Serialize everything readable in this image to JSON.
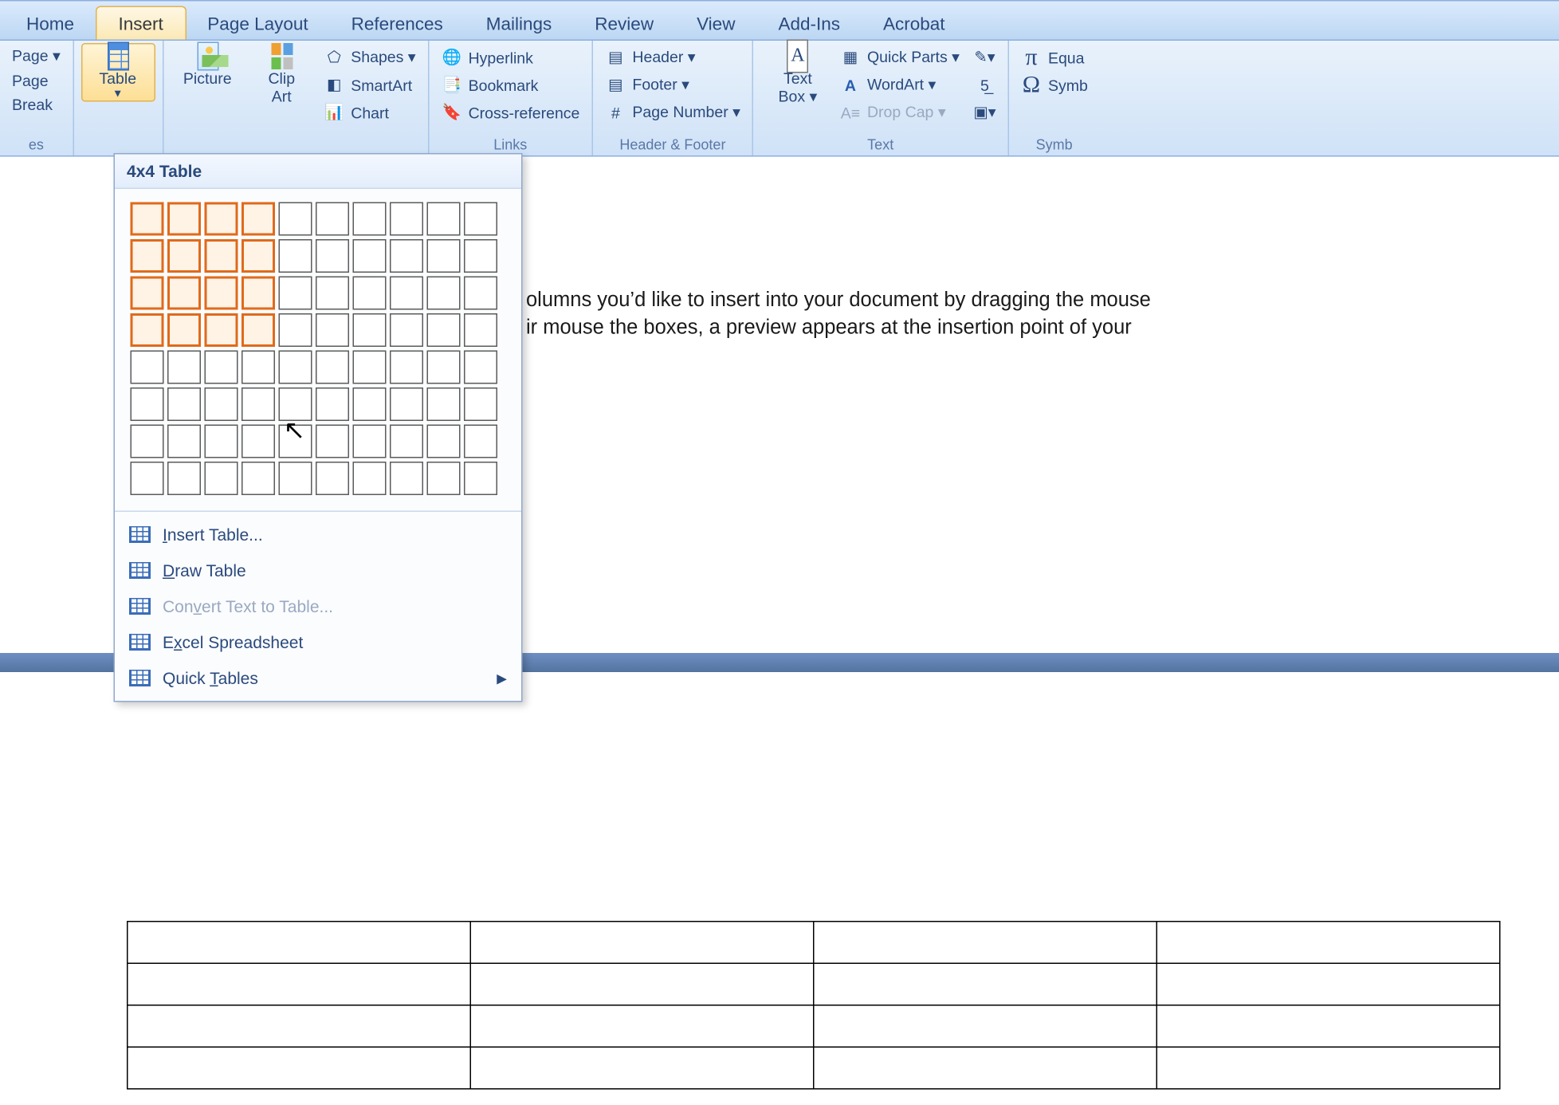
{
  "tabs": {
    "items": [
      "Home",
      "Insert",
      "Page Layout",
      "References",
      "Mailings",
      "Review",
      "View",
      "Add-Ins",
      "Acrobat"
    ],
    "active": 1
  },
  "ribbon": {
    "pages": {
      "label": "es",
      "items": [
        "Page ▾",
        "Page",
        "Break"
      ]
    },
    "tables": {
      "label": "",
      "table": "Table"
    },
    "illus": {
      "picture": "Picture",
      "clip": "Clip\nArt",
      "shapes": "Shapes ▾",
      "smart": "SmartArt",
      "chart": "Chart"
    },
    "links": {
      "label": "Links",
      "hyper": "Hyperlink",
      "book": "Bookmark",
      "cross": "Cross-reference"
    },
    "hf": {
      "label": "Header & Footer",
      "header": "Header ▾",
      "footer": "Footer ▾",
      "page": "Page Number ▾"
    },
    "text": {
      "label": "Text",
      "box": "Text\nBox ▾",
      "quick": "Quick Parts ▾",
      "wordart": "WordArt ▾",
      "drop": "Drop Cap ▾"
    },
    "sym": {
      "label": "Symb",
      "eq": "Equa",
      "sym": "Symb"
    }
  },
  "dropdown": {
    "title": "4x4 Table",
    "sel_rows": 4,
    "sel_cols": 4,
    "rows": 8,
    "cols": 10,
    "items": [
      {
        "label": "Insert Table...",
        "u": "I"
      },
      {
        "label": "Draw Table",
        "u": "D"
      },
      {
        "label": "Convert Text to Table...",
        "u": "v",
        "disabled": true
      },
      {
        "label": "Excel Spreadsheet",
        "u": "x"
      },
      {
        "label": "Quick Tables",
        "u": "T",
        "arrow": true
      }
    ]
  },
  "doc": {
    "line1": "olumns you’d like to insert into your document by dragging the mouse",
    "line2": "ir mouse the boxes, a preview appears at the insertion point of your"
  },
  "preview": {
    "rows": 4,
    "cols": 4
  }
}
